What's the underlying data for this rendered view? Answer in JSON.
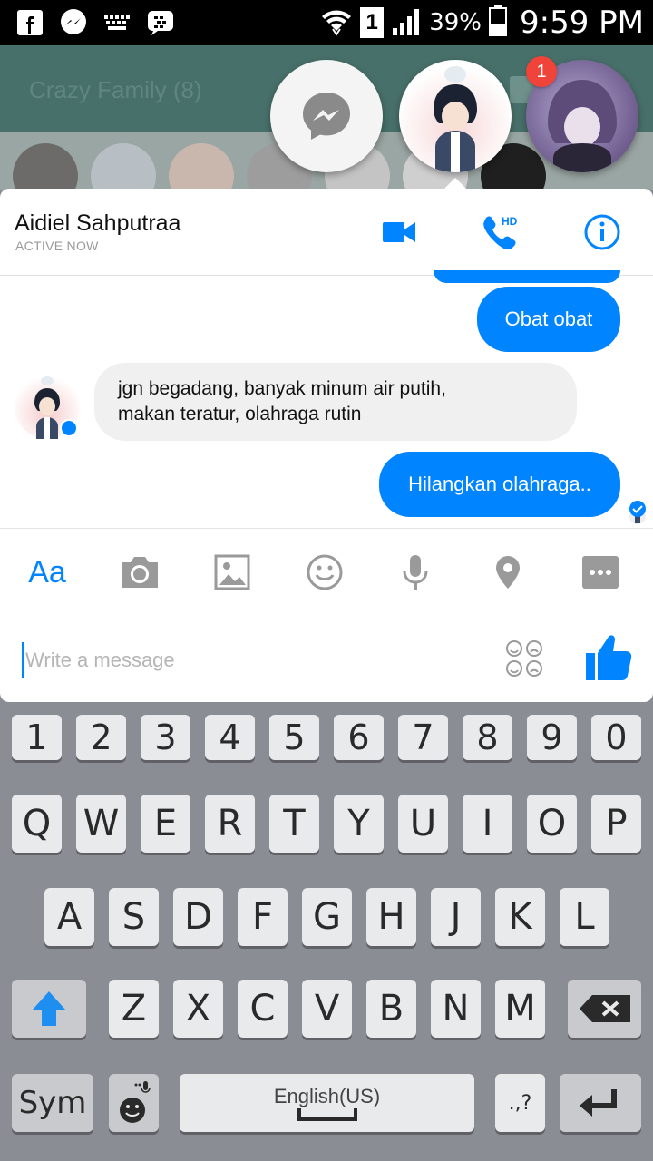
{
  "status_bar": {
    "battery_percent": "39%",
    "time": "9:59 PM",
    "sim_slot": "1",
    "icons": [
      "facebook-icon",
      "messenger-icon",
      "keyboard-icon",
      "bbm-icon",
      "wifi-icon",
      "sim-icon",
      "signal-icon",
      "battery-icon"
    ]
  },
  "background_app": {
    "group_title": "Crazy Family (8)"
  },
  "chat_heads": {
    "badge_count": "1"
  },
  "conversation": {
    "contact_name": "Aidiel Sahputraa",
    "contact_status": "ACTIVE NOW",
    "hd_label": "HD",
    "messages": [
      {
        "direction": "out",
        "text": "Obat obat"
      },
      {
        "direction": "in",
        "lines": [
          "jgn begadang, banyak minum air putih,",
          "makan teratur, olahraga rutin"
        ]
      },
      {
        "direction": "out",
        "text": "Hilangkan olahraga.."
      }
    ]
  },
  "composer": {
    "text_tool_label": "Aa",
    "placeholder": "Write a message",
    "value": ""
  },
  "keyboard": {
    "number_row": [
      "1",
      "2",
      "3",
      "4",
      "5",
      "6",
      "7",
      "8",
      "9",
      "0"
    ],
    "row1": [
      "Q",
      "W",
      "E",
      "R",
      "T",
      "Y",
      "U",
      "I",
      "O",
      "P"
    ],
    "row2": [
      "A",
      "S",
      "D",
      "F",
      "G",
      "H",
      "J",
      "K",
      "L"
    ],
    "row3": [
      "Z",
      "X",
      "C",
      "V",
      "B",
      "N",
      "M"
    ],
    "sym_label": "Sym",
    "space_label": "English(US)",
    "punct_label": ".,?"
  },
  "colors": {
    "accent": "#0084ff",
    "incoming_bubble": "#f1f0f0",
    "badge": "#f0443a",
    "keyboard_bg": "#8a8d93"
  }
}
